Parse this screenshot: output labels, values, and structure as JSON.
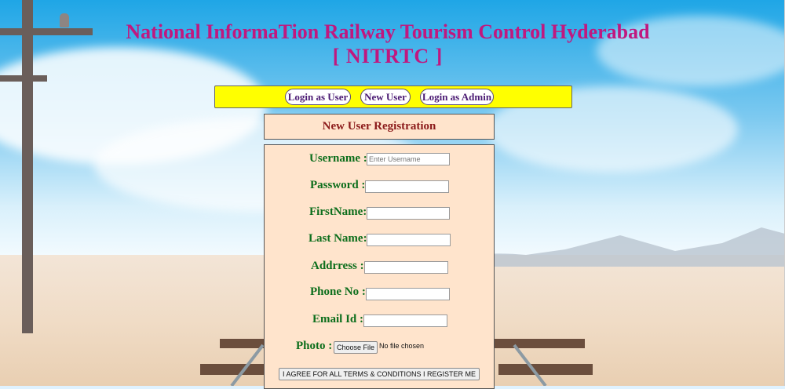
{
  "header": {
    "title_line1": "National InformaTion Railway Tourism Control Hyderabad",
    "title_line2": "[ NITRTC ]"
  },
  "nav": {
    "items": [
      {
        "label": "Login as User"
      },
      {
        "label": "New User"
      },
      {
        "label": "Login as Admin"
      }
    ],
    "background_color": "#ffff00",
    "text_color": "#4b1a73"
  },
  "registration": {
    "heading": "New User Registration",
    "fields": [
      {
        "label": "Username :",
        "placeholder": "Enter Username",
        "value": ""
      },
      {
        "label": "Password :",
        "placeholder": "",
        "value": ""
      },
      {
        "label": "FirstName:",
        "placeholder": "",
        "value": ""
      },
      {
        "label": "Last Name:",
        "placeholder": "",
        "value": ""
      },
      {
        "label": "Addrress :",
        "placeholder": "",
        "value": ""
      },
      {
        "label": "Phone No :",
        "placeholder": "",
        "value": ""
      },
      {
        "label": "Email Id :",
        "placeholder": "",
        "value": ""
      }
    ],
    "photo": {
      "label": "Photo :",
      "button_label": "Choose File",
      "status": "No file chosen"
    },
    "submit_label": "I AGREE FOR ALL TERMS & CONDITIONS I REGISTER ME"
  },
  "colors": {
    "title": "#c0187f",
    "label": "#0d6e1c",
    "heading": "#8b1a1a",
    "panel_bg": "#ffe4cc"
  }
}
